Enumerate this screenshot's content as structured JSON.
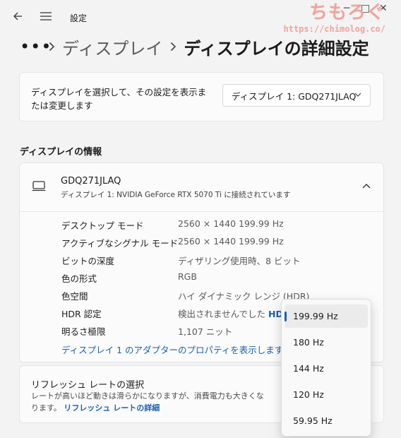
{
  "titlebar": {
    "title": "設定"
  },
  "watermark": {
    "logo": "ちもろぐ",
    "url": "https://chimolog.co/"
  },
  "breadcrumb": {
    "dots": "•••",
    "parent": "ディスプレイ",
    "current": "ディスプレイの詳細設定"
  },
  "select_display": {
    "description": "ディスプレイを選択して、その設定を表示または変更します",
    "selected": "ディスプレイ 1: GDQ271JLAQ"
  },
  "info_section": {
    "title": "ディスプレイの情報"
  },
  "monitor": {
    "name": "GDQ271JLAQ",
    "subtitle": "ディスプレイ 1: NVIDIA GeForce RTX 5070 Ti に接続されています",
    "rows": [
      {
        "label": "デスクトップ モード",
        "value": "2560 × 1440 199.99 Hz"
      },
      {
        "label": "アクティブなシグナル モード",
        "value": "2560 × 1440 199.99 Hz"
      },
      {
        "label": "ビットの深度",
        "value": "ディザリング使用時、8 ビット"
      },
      {
        "label": "色の形式",
        "value": "RGB"
      },
      {
        "label": "色空間",
        "value": "ハイ ダイナミック レンジ (HDR)"
      },
      {
        "label": "HDR 認定",
        "value": "検出されませんでした",
        "link": "HDR"
      },
      {
        "label": "明るさ極限",
        "value": "1,107 ニット"
      }
    ],
    "adapter_link": "ディスプレイ 1 のアダプターのプロパティを表示します"
  },
  "refresh": {
    "title": "リフレッシュ レートの選択",
    "description": "レートが高いほど動きは滑らかになりますが、消費電力も大きくなります。",
    "link": "リフレッシュ レートの詳細"
  },
  "flyout": {
    "selected_index": 0,
    "options": [
      "199.99 Hz",
      "180 Hz",
      "144 Hz",
      "120 Hz",
      "59.95 Hz"
    ]
  },
  "colors": {
    "accent": "#1a5fb4",
    "watermark": "#f1a39b"
  }
}
